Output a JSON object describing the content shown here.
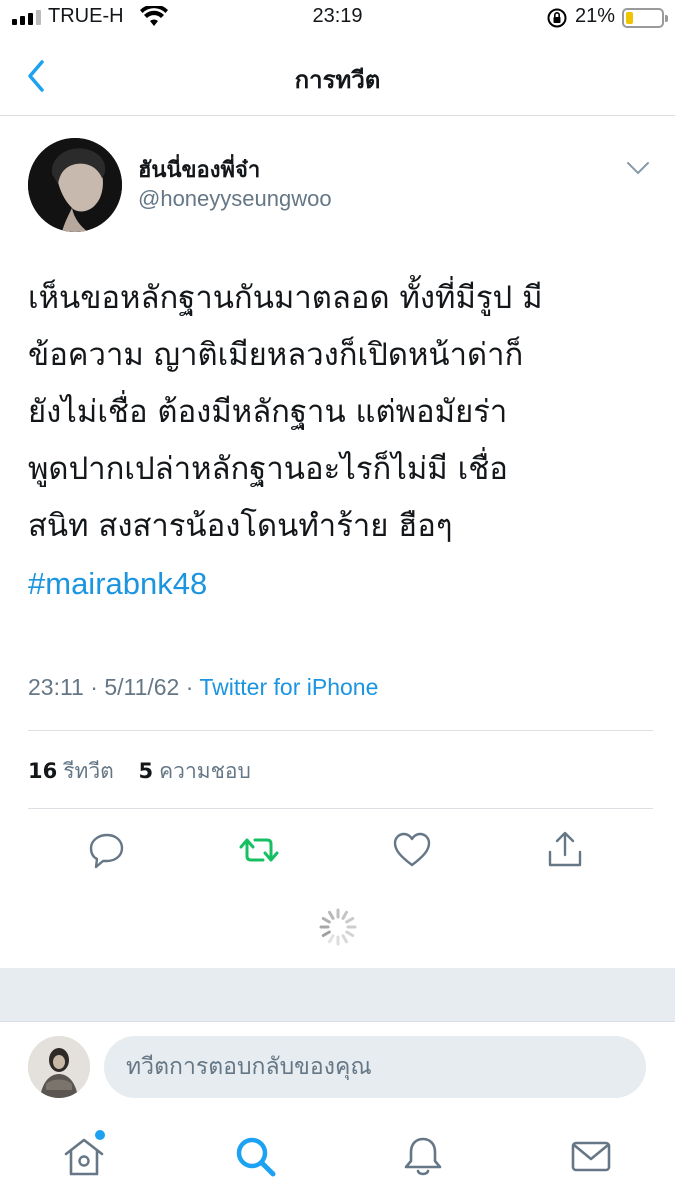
{
  "status_bar": {
    "carrier": "TRUE-H",
    "time": "23:19",
    "battery_percent": "21%",
    "battery_level": 0.21,
    "icons": [
      "signal-icon",
      "wifi-icon",
      "rotation-lock-icon",
      "battery-icon"
    ]
  },
  "nav": {
    "title": "การทวีต",
    "back_icon": "chevron-left-icon"
  },
  "tweet": {
    "display_name": "ฮันนี่ของพี่จ๋า",
    "handle": "@honeyyseungwoo",
    "text_lines": [
      "เห็นขอหลักฐานกันมาตลอด ทั้งที่มีรูป มี",
      "ข้อความ ญาติเมียหลวงก็เปิดหน้าด่าก็",
      "ยังไม่เชื่อ ต้องมีหลักฐาน แต่พอมัยร่า",
      "พูดปากเปล่าหลักฐานอะไรก็ไม่มี เชื่อ",
      "สนิท สงสารน้องโดนทำร้าย ฮือๆ"
    ],
    "hashtag": "#mairabnk48",
    "time": "23:11",
    "date": "5/11/62",
    "separator": "·",
    "source": "Twitter for iPhone",
    "retweets_count": "16",
    "retweets_label": "รีทวีต",
    "likes_count": "5",
    "likes_label": "ความชอบ"
  },
  "actions": [
    "reply-icon",
    "retweet-icon",
    "like-icon",
    "share-icon"
  ],
  "reply": {
    "placeholder": "ทวีตการตอบกลับของคุณ"
  },
  "tabs": [
    "home-icon",
    "search-icon",
    "notifications-icon",
    "messages-icon"
  ],
  "colors": {
    "accent": "#1da1f2",
    "link": "#1b95e0",
    "retweet_green": "#17bf63",
    "secondary_text": "#657786",
    "divider": "#dcdfe3",
    "band": "#e6ecf0"
  }
}
